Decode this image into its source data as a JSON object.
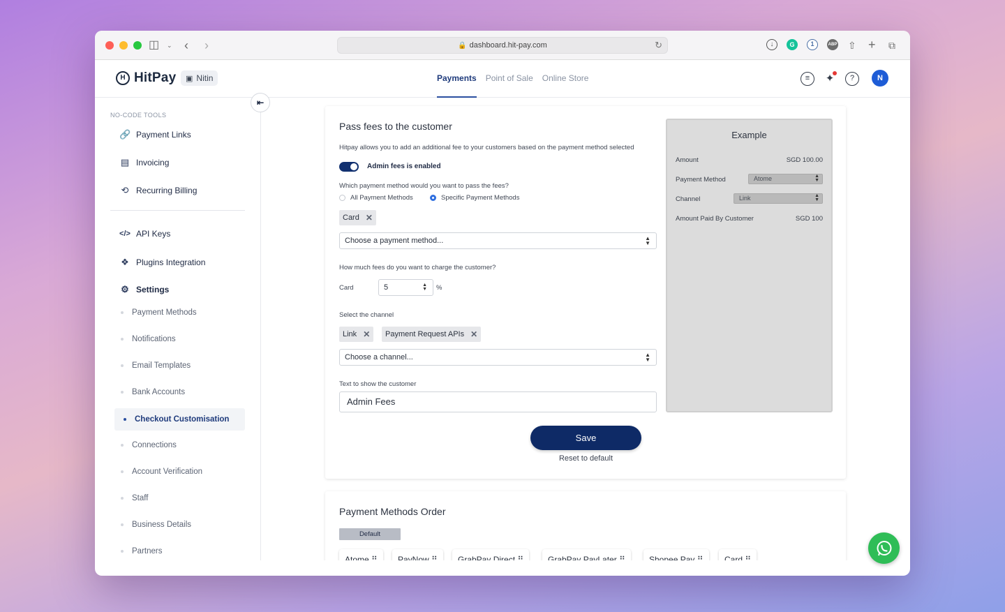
{
  "browser": {
    "url": "dashboard.hit-pay.com"
  },
  "header": {
    "brand": "HitPay",
    "store_name": "Nitin",
    "tabs": [
      {
        "label": "Payments",
        "active": true
      },
      {
        "label": "Point of Sale",
        "active": false
      },
      {
        "label": "Online Store",
        "active": false
      }
    ],
    "avatar_initial": "N",
    "accent_color": "#0e2a66"
  },
  "sidebar": {
    "section_label": "NO-CODE TOOLS",
    "tools": [
      {
        "label": "Payment Links",
        "icon": "link-icon"
      },
      {
        "label": "Invoicing",
        "icon": "invoice-icon"
      },
      {
        "label": "Recurring Billing",
        "icon": "recurring-icon"
      }
    ],
    "dev": [
      {
        "label": "API Keys",
        "icon": "code-icon"
      },
      {
        "label": "Plugins Integration",
        "icon": "puzzle-icon"
      },
      {
        "label": "Settings",
        "icon": "gear-icon"
      }
    ],
    "settings_items": [
      {
        "label": "Payment Methods",
        "active": false
      },
      {
        "label": "Notifications",
        "active": false
      },
      {
        "label": "Email Templates",
        "active": false
      },
      {
        "label": "Bank Accounts",
        "active": false
      },
      {
        "label": "Checkout Customisation",
        "active": true
      },
      {
        "label": "Connections",
        "active": false
      },
      {
        "label": "Account Verification",
        "active": false
      },
      {
        "label": "Staff",
        "active": false
      },
      {
        "label": "Business Details",
        "active": false
      },
      {
        "label": "Partners",
        "active": false
      }
    ]
  },
  "fees": {
    "title": "Pass fees to the customer",
    "description": "Hitpay allows you to add an additional fee to your customers based on the payment method selected",
    "toggle_label": "Admin fees is enabled",
    "toggle_on": true,
    "method_question": "Which payment method would you want to pass the fees?",
    "radio_all": "All Payment Methods",
    "radio_specific": "Specific Payment Methods",
    "selected_radio": "specific",
    "method_chips": [
      "Card"
    ],
    "method_placeholder": "Choose a payment method...",
    "fee_question": "How much fees do you want to charge the customer?",
    "fee_label": "Card",
    "fee_value": "5",
    "fee_unit": "%",
    "channel_label": "Select the channel",
    "channel_chips": [
      "Link",
      "Payment Request APIs"
    ],
    "channel_placeholder": "Choose a channel...",
    "text_label": "Text to show the customer",
    "text_value": "Admin Fees",
    "save_label": "Save",
    "reset_label": "Reset to default"
  },
  "example": {
    "title": "Example",
    "amount_label": "Amount",
    "amount_value": "SGD 100.00",
    "method_label": "Payment Method",
    "method_value": "Atome",
    "channel_label": "Channel",
    "channel_value": "Link",
    "paid_label": "Amount Paid By Customer",
    "paid_value": "SGD 100"
  },
  "order": {
    "title": "Payment Methods Order",
    "default_label": "Default",
    "methods": [
      "Atome",
      "PayNow",
      "GrabPay Direct",
      "GrabPay PayLater",
      "Shopee Pay",
      "Card"
    ]
  }
}
